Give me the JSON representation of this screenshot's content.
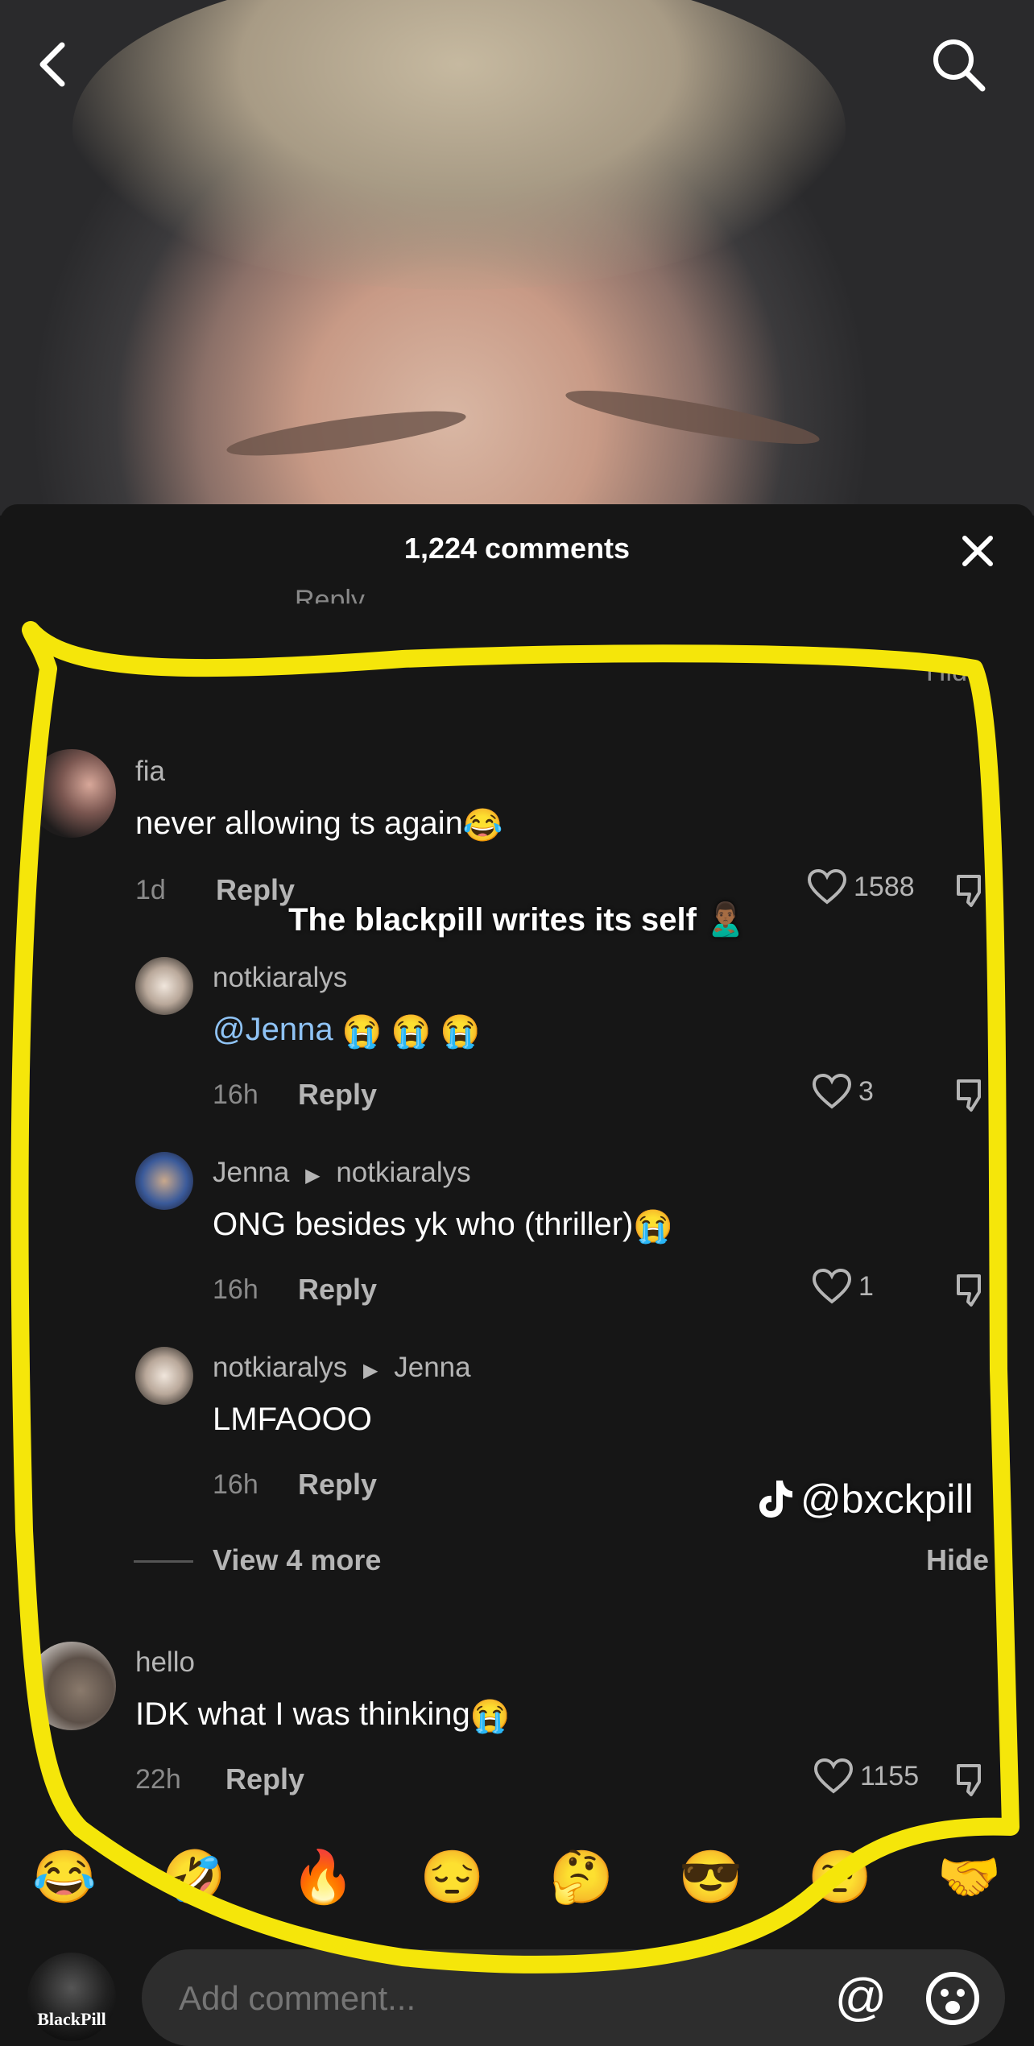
{
  "top_bar": {
    "back_icon": "chevron-left-icon",
    "search_icon": "search-icon"
  },
  "sheet": {
    "title": "1,224 comments",
    "close_icon": "close-icon"
  },
  "peek_row": {
    "reply_label": "Reply",
    "hide_label": "Hide"
  },
  "overlay_caption": "The blackpill writes its self 🙎🏾‍♂️",
  "watermark": {
    "handle": "@bxckpill",
    "icon": "tiktok-logo-icon"
  },
  "comments": [
    {
      "username": "fia",
      "text": "never allowing ts again",
      "emoji": "😂",
      "time": "1d",
      "reply": "Reply",
      "likes": "1588"
    },
    {
      "username": "notkiaralys",
      "mention": "@Jenna",
      "text": "",
      "emoji": "😭 😭 😭",
      "time": "16h",
      "reply": "Reply",
      "likes": "3"
    },
    {
      "username": "Jenna",
      "reply_to": "notkiaralys",
      "text": "ONG besides yk who (thriller)",
      "emoji": "😭",
      "time": "16h",
      "reply": "Reply",
      "likes": "1"
    },
    {
      "username": "notkiaralys",
      "reply_to": "Jenna",
      "text": "LMFAOOO",
      "time": "16h",
      "reply": "Reply",
      "likes": ""
    },
    {
      "username": "hello",
      "text": "IDK what I was thinking",
      "emoji": "😭",
      "time": "22h",
      "reply": "Reply",
      "likes": "1155"
    }
  ],
  "view_more": {
    "label": "View 4 more",
    "hide": "Hide"
  },
  "reactions": [
    "😂",
    "🤣",
    "🔥",
    "😔",
    "🤔",
    "😎",
    "🤨",
    "🤝"
  ],
  "composer": {
    "placeholder": "Add comment...",
    "avatar_text": "BlackPill",
    "at_symbol": "@"
  },
  "colors": {
    "background": "#161616",
    "highlight": "#f5e60a",
    "mention": "#8fc3f5"
  }
}
